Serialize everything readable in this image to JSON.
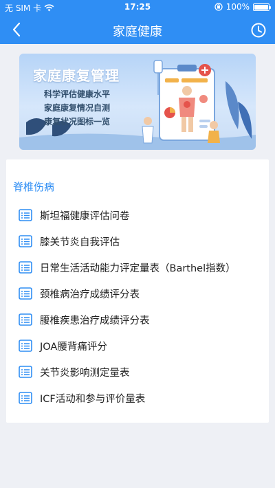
{
  "status_bar": {
    "carrier": "无 SIM 卡",
    "time": "17:25",
    "battery": "100%"
  },
  "nav": {
    "title": "家庭健康",
    "back_icon": "chevron-left-icon",
    "history_icon": "clock-icon"
  },
  "banner": {
    "title": "家庭康复管理",
    "lines": [
      "科学评估健康水平",
      "家庭康复情况自测",
      "康复状况图标一览"
    ]
  },
  "section": {
    "title": "脊椎伤病",
    "items": [
      {
        "label": "斯坦福健康评估问卷"
      },
      {
        "label": "膝关节炎自我评估"
      },
      {
        "label": "日常生活活动能力评定量表（Barthel指数）"
      },
      {
        "label": "颈椎病治疗成绩评分表"
      },
      {
        "label": "腰椎疾患治疗成绩评分表"
      },
      {
        "label": "JOA腰背痛评分"
      },
      {
        "label": "关节炎影响测定量表"
      },
      {
        "label": "ICF活动和参与评价量表"
      }
    ]
  },
  "colors": {
    "accent": "#2f8ef4",
    "background": "#eef0f5"
  }
}
